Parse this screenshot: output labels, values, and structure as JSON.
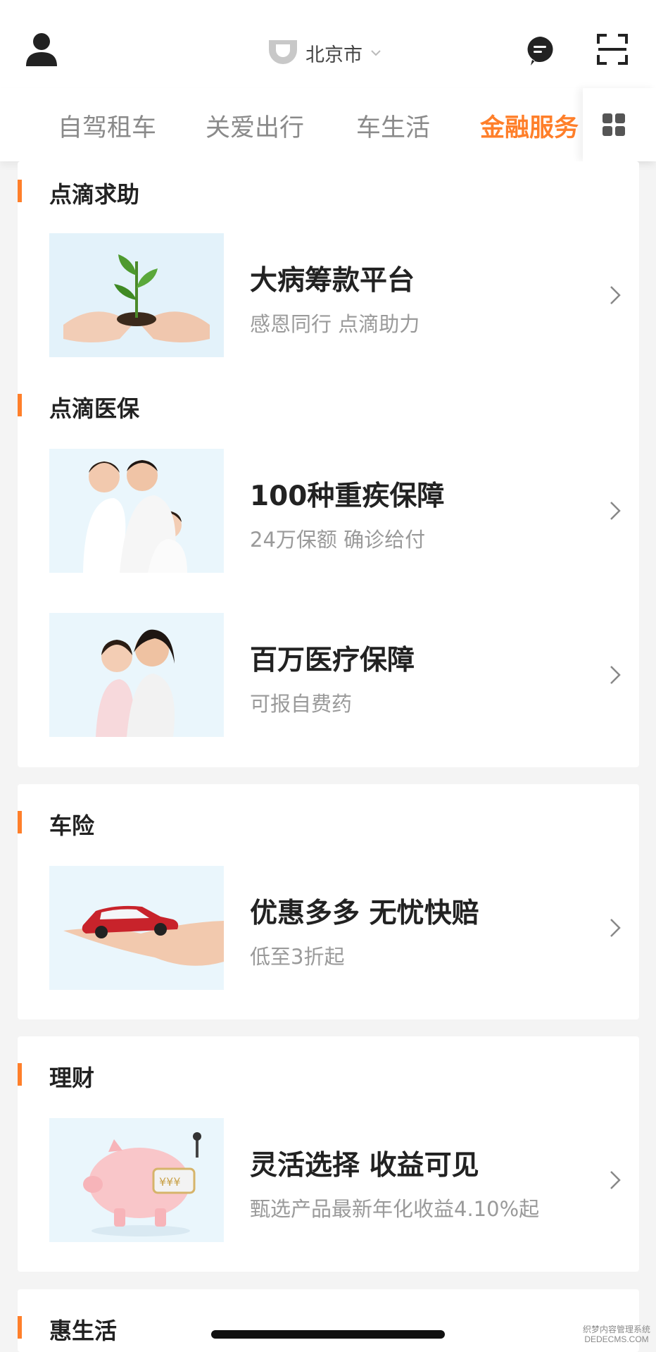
{
  "header": {
    "city": "北京市"
  },
  "tabs": [
    {
      "label": "自驾租车",
      "active": false
    },
    {
      "label": "关爱出行",
      "active": false
    },
    {
      "label": "车生活",
      "active": false
    },
    {
      "label": "金融服务",
      "active": true
    }
  ],
  "colors": {
    "accent": "#ff7f2a",
    "title": "#222222",
    "subtitle": "#9a9a9a",
    "tab_inactive": "#8a8a8a",
    "background": "#f4f4f4"
  },
  "sections": [
    {
      "title": "点滴求助",
      "items": [
        {
          "title": "大病筹款平台",
          "subtitle": "感恩同行 点滴助力",
          "image": "hands-with-sprout"
        }
      ]
    },
    {
      "title": "点滴医保",
      "items": [
        {
          "title": "100种重疾保障",
          "subtitle": "24万保额 确诊给付",
          "image": "family-photo"
        },
        {
          "title": "百万医疗保障",
          "subtitle": "可报自费药",
          "image": "mother-daughter-photo"
        }
      ]
    },
    {
      "title": "车险",
      "items": [
        {
          "title": "优惠多多 无忧快赔",
          "subtitle": "低至3折起",
          "image": "car-on-hand"
        }
      ]
    },
    {
      "title": "理财",
      "items": [
        {
          "title": "灵活选择 收益可见",
          "subtitle": "甄选产品最新年化收益4.10%起",
          "image": "piggy-bank"
        }
      ]
    },
    {
      "title": "惠生活",
      "items": []
    }
  ],
  "watermark": {
    "line1": "织梦内容管理系统",
    "line2": "DEDECMS.COM"
  }
}
